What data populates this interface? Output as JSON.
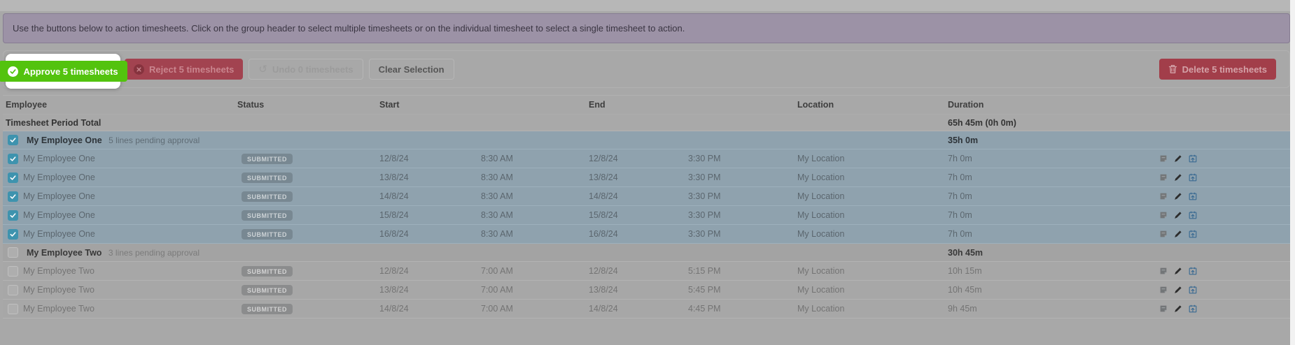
{
  "banner": {
    "text": "Use the buttons below to action timesheets. Click on the group header to select multiple timesheets or on the individual timesheet to select a single timesheet to action."
  },
  "toolbar": {
    "approve_label": "Approve 5 timesheets",
    "reject_label": "Reject 5 timesheets",
    "undo_label": "Undo 0 timesheets",
    "clear_label": "Clear Selection",
    "delete_label": "Delete 5 timesheets"
  },
  "icons": {
    "approve": "check-circle-icon",
    "reject": "x-circle-icon",
    "undo": "undo-arrow-icon",
    "delete": "trash-icon",
    "row_actions": [
      "note-icon",
      "pencil-icon",
      "calendar-up-icon"
    ]
  },
  "colors": {
    "approve_green": "#53c30e",
    "reject_red": "#a24350",
    "delete_red": "#a23e4a",
    "banner_purple": "#9c92a6",
    "selected_row": "#8fa2ae",
    "checkbox_teal": "#3e93ae",
    "spotlight_white": "#ffffff",
    "page_gray": "#a8a8a8"
  },
  "table": {
    "columns": [
      "Employee",
      "Status",
      "Start",
      "End",
      "Location",
      "Duration"
    ],
    "total_label": "Timesheet Period Total",
    "total_duration": "65h 45m (0h 0m)",
    "groups": [
      {
        "name": "My Employee One",
        "sub": "5 lines pending approval",
        "duration": "35h 0m",
        "checked": true,
        "rows": [
          {
            "name": "My Employee One",
            "status": "SUBMITTED",
            "start_date": "12/8/24",
            "start_time": "8:30 AM",
            "end_date": "12/8/24",
            "end_time": "3:30 PM",
            "location": "My Location",
            "duration": "7h 0m",
            "checked": true
          },
          {
            "name": "My Employee One",
            "status": "SUBMITTED",
            "start_date": "13/8/24",
            "start_time": "8:30 AM",
            "end_date": "13/8/24",
            "end_time": "3:30 PM",
            "location": "My Location",
            "duration": "7h 0m",
            "checked": true
          },
          {
            "name": "My Employee One",
            "status": "SUBMITTED",
            "start_date": "14/8/24",
            "start_time": "8:30 AM",
            "end_date": "14/8/24",
            "end_time": "3:30 PM",
            "location": "My Location",
            "duration": "7h 0m",
            "checked": true
          },
          {
            "name": "My Employee One",
            "status": "SUBMITTED",
            "start_date": "15/8/24",
            "start_time": "8:30 AM",
            "end_date": "15/8/24",
            "end_time": "3:30 PM",
            "location": "My Location",
            "duration": "7h 0m",
            "checked": true
          },
          {
            "name": "My Employee One",
            "status": "SUBMITTED",
            "start_date": "16/8/24",
            "start_time": "8:30 AM",
            "end_date": "16/8/24",
            "end_time": "3:30 PM",
            "location": "My Location",
            "duration": "7h 0m",
            "checked": true
          }
        ]
      },
      {
        "name": "My Employee Two",
        "sub": "3 lines pending approval",
        "duration": "30h 45m",
        "checked": false,
        "rows": [
          {
            "name": "My Employee Two",
            "status": "SUBMITTED",
            "start_date": "12/8/24",
            "start_time": "7:00 AM",
            "end_date": "12/8/24",
            "end_time": "5:15 PM",
            "location": "My Location",
            "duration": "10h 15m",
            "checked": false
          },
          {
            "name": "My Employee Two",
            "status": "SUBMITTED",
            "start_date": "13/8/24",
            "start_time": "7:00 AM",
            "end_date": "13/8/24",
            "end_time": "5:45 PM",
            "location": "My Location",
            "duration": "10h 45m",
            "checked": false
          },
          {
            "name": "My Employee Two",
            "status": "SUBMITTED",
            "start_date": "14/8/24",
            "start_time": "7:00 AM",
            "end_date": "14/8/24",
            "end_time": "4:45 PM",
            "location": "My Location",
            "duration": "9h 45m",
            "checked": false
          }
        ]
      }
    ]
  }
}
